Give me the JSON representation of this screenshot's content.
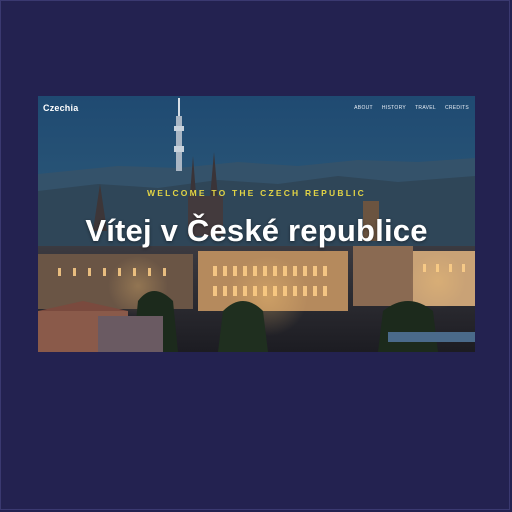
{
  "page": {
    "background": "#232250"
  },
  "navbar": {
    "brand": "Czechia",
    "links": [
      {
        "label": "ABOUT"
      },
      {
        "label": "HISTORY"
      },
      {
        "label": "TRAVEL"
      },
      {
        "label": "CREDITS"
      }
    ]
  },
  "hero": {
    "kicker": "WELCOME TO THE CZECH REPUBLIC",
    "title": "Vítej v České republice",
    "background_image": "prague-city-night-photo",
    "colors": {
      "kicker": "#e2d445",
      "title": "#ffffff",
      "sky": "#1f3b5e",
      "lights": "#f2a24a"
    }
  }
}
